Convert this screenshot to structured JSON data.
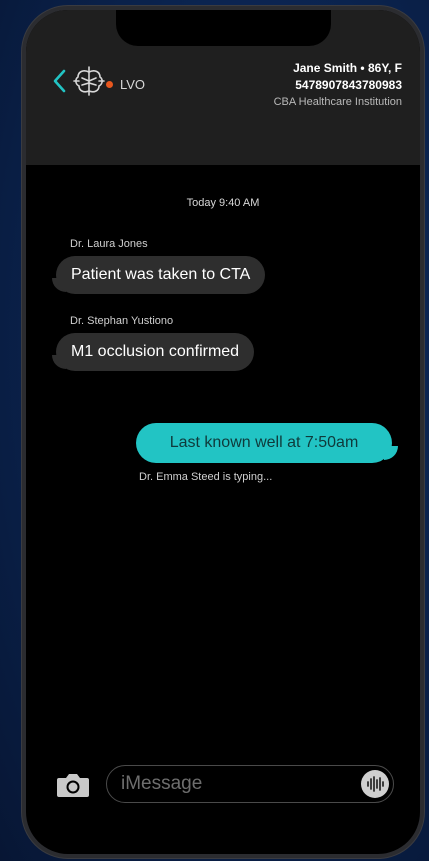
{
  "header": {
    "channel": "LVO",
    "patient_name": "Jane Smith • 86Y, F",
    "patient_id": "5478907843780983",
    "institution": "CBA Healthcare Institution"
  },
  "conversation": {
    "timestamp": "Today 9:40 AM",
    "messages": [
      {
        "sender": "Dr. Laura Jones",
        "text": "Patient was taken to CTA",
        "direction": "incoming"
      },
      {
        "sender": "Dr. Stephan Yustiono",
        "text": "M1 occlusion confirmed",
        "direction": "incoming"
      },
      {
        "sender": "",
        "text": "Last known well at 7:50am",
        "direction": "outgoing"
      }
    ],
    "typing_indicator": "Dr. Emma Steed is typing..."
  },
  "composer": {
    "placeholder": "iMessage",
    "camera_icon": "camera-icon",
    "audio_icon": "waveform-icon"
  },
  "colors": {
    "accent": "#22c4c4",
    "status_dot": "#e8571e",
    "incoming_bubble": "#2e2e2e"
  }
}
